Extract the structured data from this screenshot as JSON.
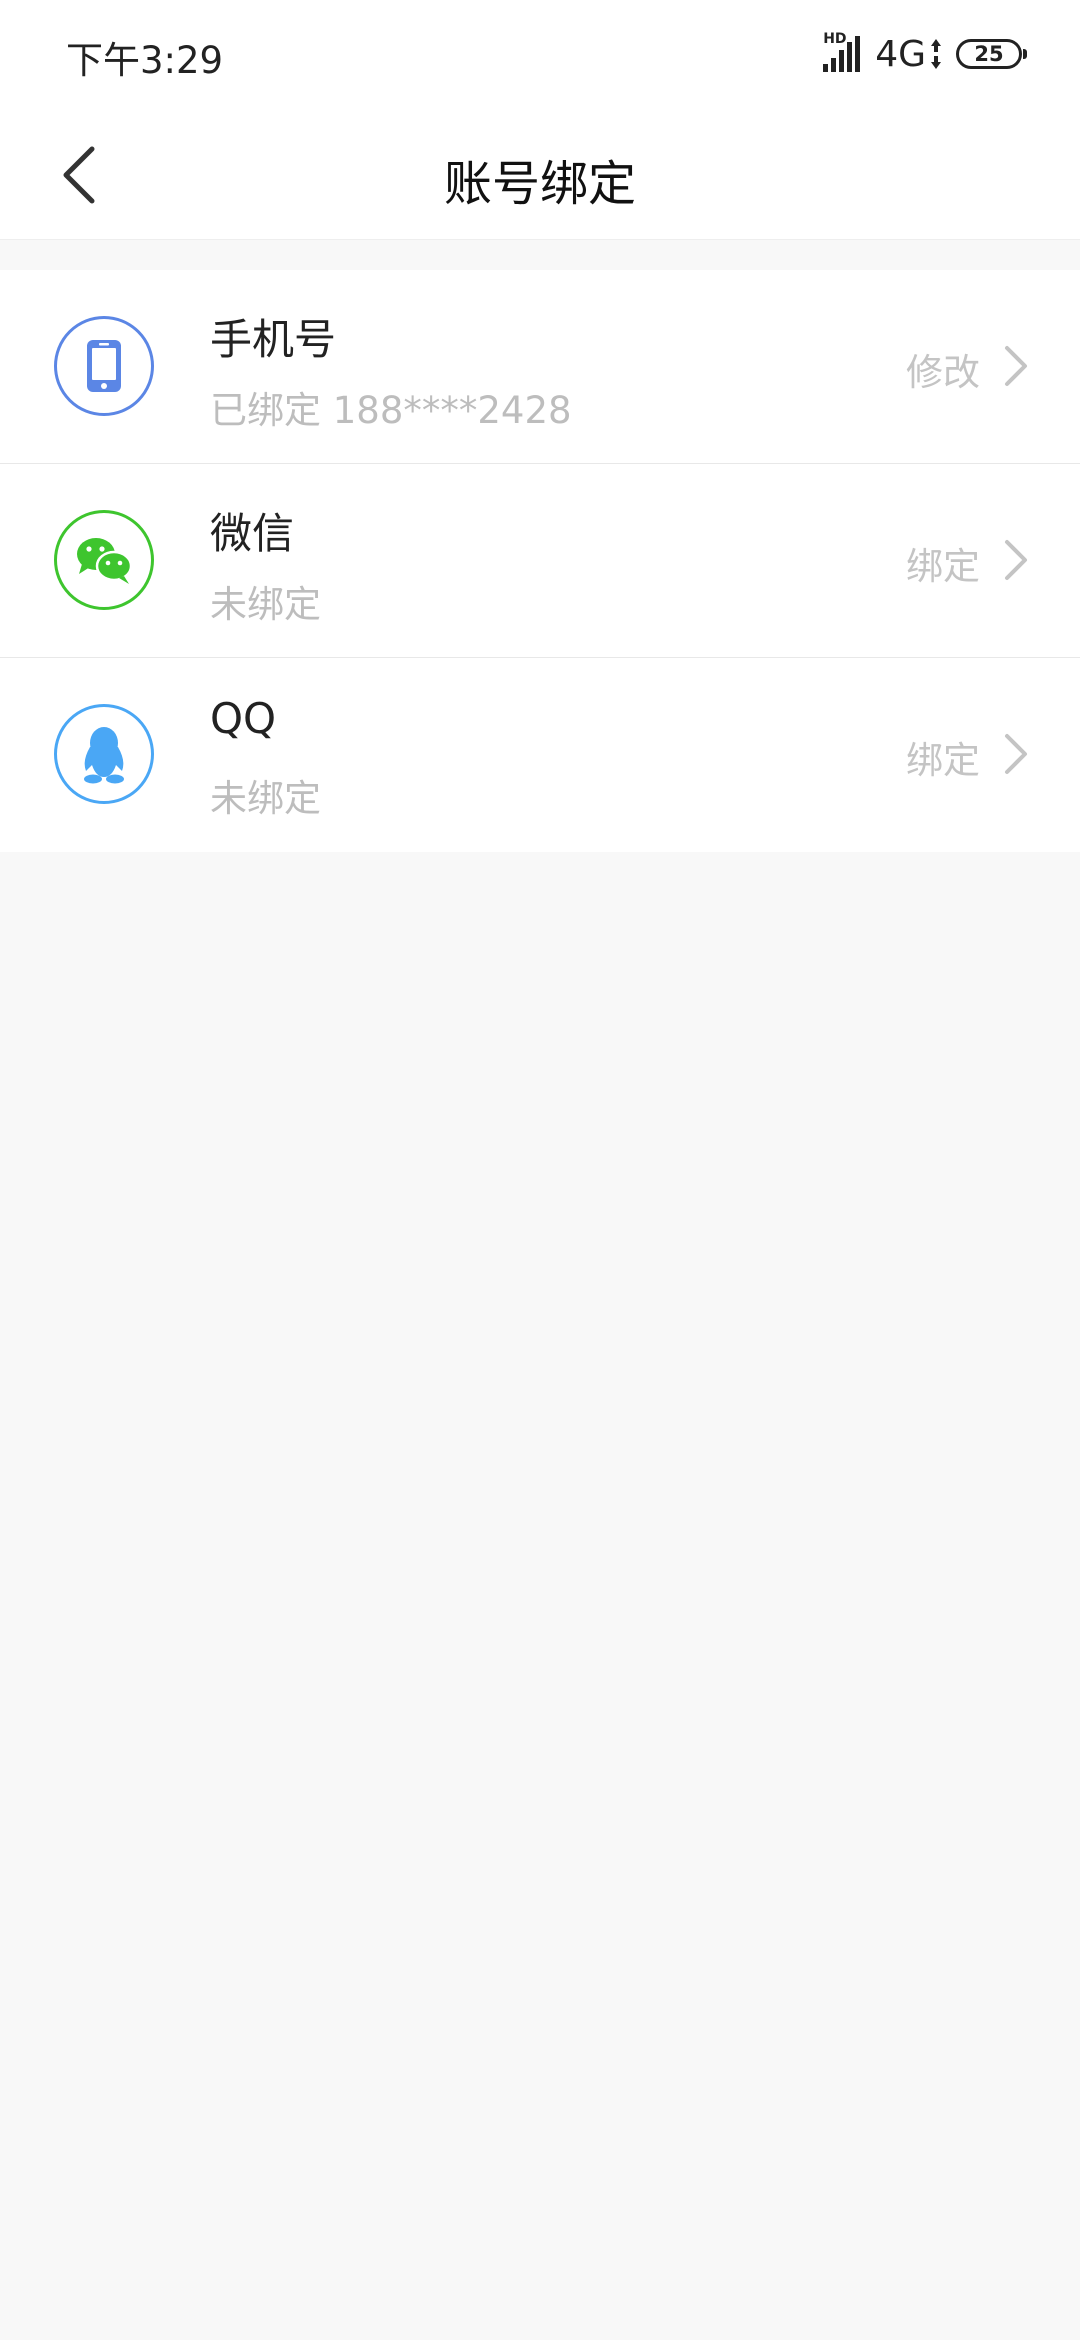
{
  "status_bar": {
    "time": "下午3:29",
    "hd": "HD",
    "network": "4G",
    "battery": "25"
  },
  "header": {
    "title": "账号绑定",
    "back_icon": "chevron-left-icon"
  },
  "accounts": [
    {
      "title": "手机号",
      "subtitle": "已绑定 188****2428",
      "action": "修改",
      "icon": "phone-icon",
      "color": "#5b86e5"
    },
    {
      "title": "微信",
      "subtitle": "未绑定",
      "action": "绑定",
      "icon": "wechat-icon",
      "color": "#3ec52e"
    },
    {
      "title": "QQ",
      "subtitle": "未绑定",
      "action": "绑定",
      "icon": "qq-icon",
      "color": "#4aa7f5"
    }
  ],
  "colors": {
    "background": "#f8f8f8",
    "surface": "#ffffff",
    "text_primary": "#222222",
    "text_secondary": "#bdbdbd"
  }
}
